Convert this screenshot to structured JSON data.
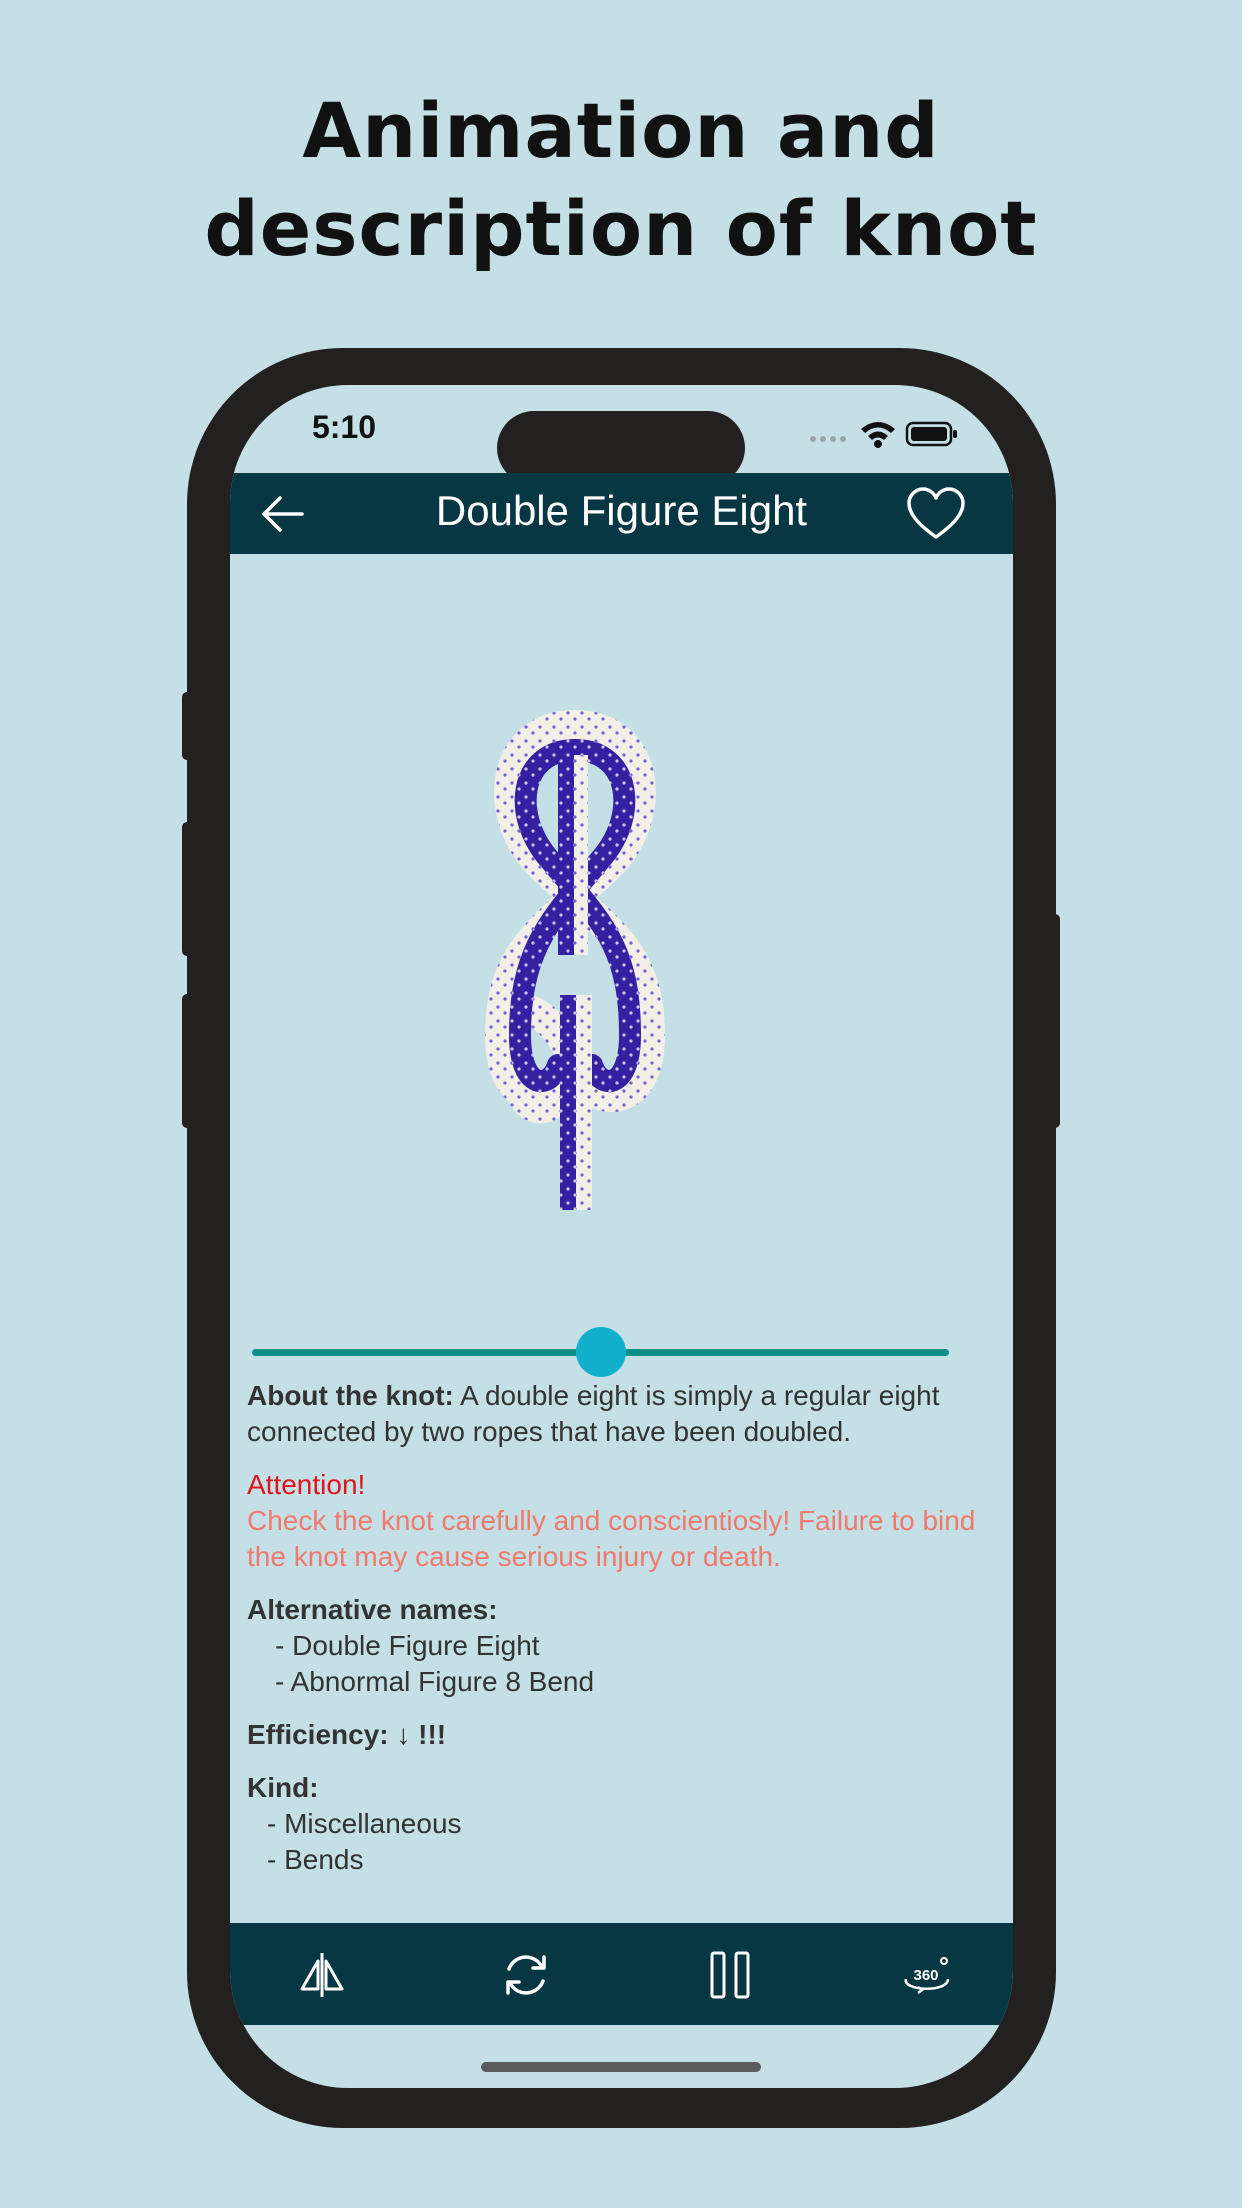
{
  "headline": {
    "line1": "Animation and",
    "line2": "description of knot"
  },
  "status_bar": {
    "time": "5:10",
    "icons": [
      "signal-dots-icon",
      "wifi-icon",
      "battery-icon"
    ]
  },
  "navbar": {
    "title": "Double Figure Eight",
    "back_icon": "arrow-left-icon",
    "favorite_icon": "heart-outline-icon",
    "background": "#073743"
  },
  "animation": {
    "knot_name": "Double Figure Eight",
    "progress": 0.5
  },
  "colors": {
    "accent": "#12b0cd",
    "track": "#0d8f8a",
    "attention_title": "#e0141b",
    "attention_text": "#f07a6c"
  },
  "description": {
    "about_label": "About the knot:",
    "about_text": " A double eight is simply a regular eight connected by two ropes that have been doubled.",
    "attention_title": "Attention!",
    "attention_text": "Check the knot carefully and conscientiosly! Failure to bind the knot may cause serious injury or death.",
    "alt_names_label": "Alternative names:",
    "alt_names": [
      "- Double Figure Eight",
      "- Abnormal Figure 8 Bend"
    ],
    "efficiency_label": "Efficiency: ↓ !!!",
    "kind_label": "Kind:",
    "kinds": [
      "- Miscellaneous",
      "- Bends"
    ]
  },
  "toolbar": {
    "buttons": [
      "mirror-icon",
      "repeat-icon",
      "pause-icon",
      "rotate-360-icon"
    ]
  }
}
